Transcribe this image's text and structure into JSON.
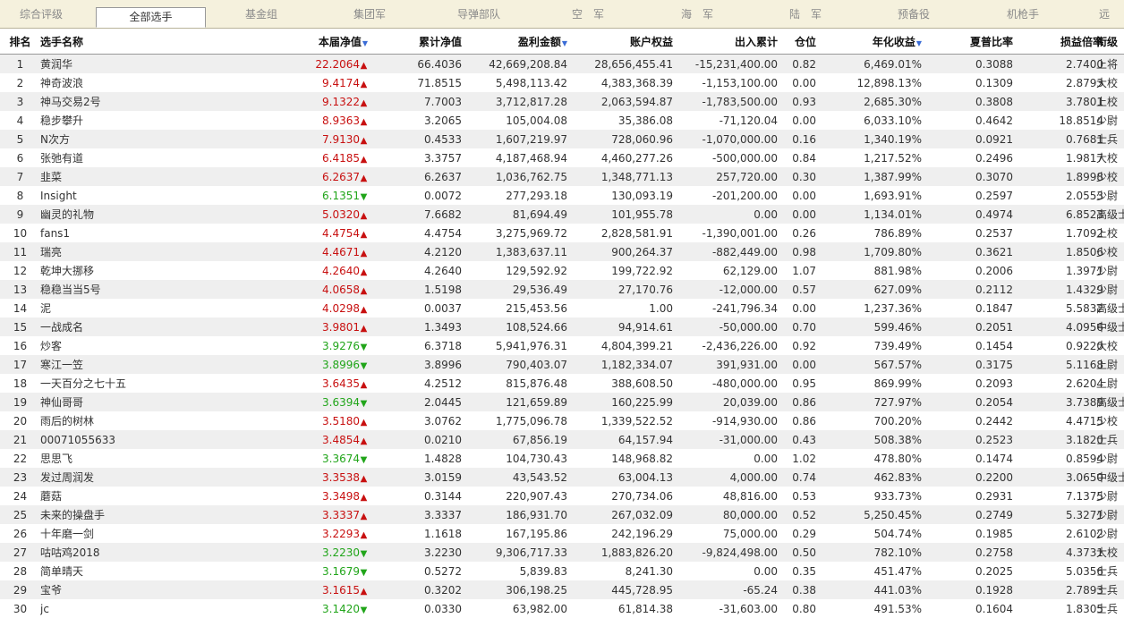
{
  "tabs": [
    {
      "label": "综合评级",
      "active": false
    },
    {
      "label": "全部选手",
      "active": true
    },
    {
      "label": "基金组",
      "active": false
    },
    {
      "label": "集团军",
      "active": false
    },
    {
      "label": "导弹部队",
      "active": false
    },
    {
      "label": "空　军",
      "active": false
    },
    {
      "label": "海　军",
      "active": false
    },
    {
      "label": "陆　军",
      "active": false
    },
    {
      "label": "预备役",
      "active": false
    },
    {
      "label": "机枪手",
      "active": false
    },
    {
      "label": "远",
      "active": false
    }
  ],
  "columns": {
    "rank": "排名",
    "name": "选手名称",
    "nav": "本届净值",
    "cum_nav": "累计净值",
    "profit": "盈利金额",
    "equity": "账户权益",
    "io": "出入累计",
    "pos": "仓位",
    "annual": "年化收益",
    "sharpe": "夏普比率",
    "pl_ratio": "损益倍率",
    "title": "衔级"
  },
  "sort_marker": "▼",
  "rows": [
    {
      "rank": "1",
      "name": "黄润华",
      "nav": "22.2064",
      "dir": "up",
      "cum_nav": "66.4036",
      "profit": "42,669,208.84",
      "equity": "28,656,455.41",
      "io": "-15,231,400.00",
      "pos": "0.82",
      "annual": "6,469.01%",
      "sharpe": "0.3088",
      "pl_ratio": "2.7400",
      "title": "上将"
    },
    {
      "rank": "2",
      "name": "神奇波浪",
      "nav": "9.4174",
      "dir": "up",
      "cum_nav": "71.8515",
      "profit": "5,498,113.42",
      "equity": "4,383,368.39",
      "io": "-1,153,100.00",
      "pos": "0.00",
      "annual": "12,898.13%",
      "sharpe": "0.1309",
      "pl_ratio": "2.8793",
      "title": "大校"
    },
    {
      "rank": "3",
      "name": "神马交易2号",
      "nav": "9.1322",
      "dir": "up",
      "cum_nav": "7.7003",
      "profit": "3,712,817.28",
      "equity": "2,063,594.87",
      "io": "-1,783,500.00",
      "pos": "0.93",
      "annual": "2,685.30%",
      "sharpe": "0.3808",
      "pl_ratio": "3.7801",
      "title": "上校"
    },
    {
      "rank": "4",
      "name": "稳步攀升",
      "nav": "8.9363",
      "dir": "up",
      "cum_nav": "3.2065",
      "profit": "105,004.08",
      "equity": "35,386.08",
      "io": "-71,120.04",
      "pos": "0.00",
      "annual": "6,033.10%",
      "sharpe": "0.4642",
      "pl_ratio": "18.8514",
      "title": "少尉"
    },
    {
      "rank": "5",
      "name": "N次方",
      "nav": "7.9130",
      "dir": "up",
      "cum_nav": "0.4533",
      "profit": "1,607,219.97",
      "equity": "728,060.96",
      "io": "-1,070,000.00",
      "pos": "0.16",
      "annual": "1,340.19%",
      "sharpe": "0.0921",
      "pl_ratio": "0.7681",
      "title": "士兵"
    },
    {
      "rank": "6",
      "name": "张弛有道",
      "nav": "6.4185",
      "dir": "up",
      "cum_nav": "3.3757",
      "profit": "4,187,468.94",
      "equity": "4,460,277.26",
      "io": "-500,000.00",
      "pos": "0.84",
      "annual": "1,217.52%",
      "sharpe": "0.2496",
      "pl_ratio": "1.9817",
      "title": "大校"
    },
    {
      "rank": "7",
      "name": "韭菜",
      "nav": "6.2637",
      "dir": "up",
      "cum_nav": "6.2637",
      "profit": "1,036,762.75",
      "equity": "1,348,771.13",
      "io": "257,720.00",
      "pos": "0.30",
      "annual": "1,387.99%",
      "sharpe": "0.3070",
      "pl_ratio": "1.8998",
      "title": "少校"
    },
    {
      "rank": "8",
      "name": "Insight",
      "nav": "6.1351",
      "dir": "down",
      "cum_nav": "0.0072",
      "profit": "277,293.18",
      "equity": "130,093.19",
      "io": "-201,200.00",
      "pos": "0.00",
      "annual": "1,693.91%",
      "sharpe": "0.2597",
      "pl_ratio": "2.0553",
      "title": "少尉"
    },
    {
      "rank": "9",
      "name": "幽灵的礼物",
      "nav": "5.0320",
      "dir": "up",
      "cum_nav": "7.6682",
      "profit": "81,694.49",
      "equity": "101,955.78",
      "io": "0.00",
      "pos": "0.00",
      "annual": "1,134.01%",
      "sharpe": "0.4974",
      "pl_ratio": "6.8523",
      "title": "高级士官"
    },
    {
      "rank": "10",
      "name": "fans1",
      "nav": "4.4754",
      "dir": "up",
      "cum_nav": "4.4754",
      "profit": "3,275,969.72",
      "equity": "2,828,581.91",
      "io": "-1,390,001.00",
      "pos": "0.26",
      "annual": "786.89%",
      "sharpe": "0.2537",
      "pl_ratio": "1.7092",
      "title": "上校"
    },
    {
      "rank": "11",
      "name": "瑞亮",
      "nav": "4.4671",
      "dir": "up",
      "cum_nav": "4.2120",
      "profit": "1,383,637.11",
      "equity": "900,264.37",
      "io": "-882,449.00",
      "pos": "0.98",
      "annual": "1,709.80%",
      "sharpe": "0.3621",
      "pl_ratio": "1.8506",
      "title": "少校"
    },
    {
      "rank": "12",
      "name": "乾坤大挪移",
      "nav": "4.2640",
      "dir": "up",
      "cum_nav": "4.2640",
      "profit": "129,592.92",
      "equity": "199,722.92",
      "io": "62,129.00",
      "pos": "1.07",
      "annual": "881.98%",
      "sharpe": "0.2006",
      "pl_ratio": "1.3971",
      "title": "少尉"
    },
    {
      "rank": "13",
      "name": "稳稳当当5号",
      "nav": "4.0658",
      "dir": "up",
      "cum_nav": "1.5198",
      "profit": "29,536.49",
      "equity": "27,170.76",
      "io": "-12,000.00",
      "pos": "0.57",
      "annual": "627.09%",
      "sharpe": "0.2112",
      "pl_ratio": "1.4329",
      "title": "少尉"
    },
    {
      "rank": "14",
      "name": "泥",
      "nav": "4.0298",
      "dir": "up",
      "cum_nav": "0.0037",
      "profit": "215,453.56",
      "equity": "1.00",
      "io": "-241,796.34",
      "pos": "0.00",
      "annual": "1,237.36%",
      "sharpe": "0.1847",
      "pl_ratio": "5.5832",
      "title": "高级士官"
    },
    {
      "rank": "15",
      "name": "一战成名",
      "nav": "3.9801",
      "dir": "up",
      "cum_nav": "1.3493",
      "profit": "108,524.66",
      "equity": "94,914.61",
      "io": "-50,000.00",
      "pos": "0.70",
      "annual": "599.46%",
      "sharpe": "0.2051",
      "pl_ratio": "4.0956",
      "title": "中级士官"
    },
    {
      "rank": "16",
      "name": "炒客",
      "nav": "3.9276",
      "dir": "down",
      "cum_nav": "6.3718",
      "profit": "5,941,976.31",
      "equity": "4,804,399.21",
      "io": "-2,436,226.00",
      "pos": "0.92",
      "annual": "739.49%",
      "sharpe": "0.1454",
      "pl_ratio": "0.9220",
      "title": "大校"
    },
    {
      "rank": "17",
      "name": "寒江一笠",
      "nav": "3.8996",
      "dir": "down",
      "cum_nav": "3.8996",
      "profit": "790,403.07",
      "equity": "1,182,334.07",
      "io": "391,931.00",
      "pos": "0.00",
      "annual": "567.57%",
      "sharpe": "0.3175",
      "pl_ratio": "5.1168",
      "title": "上尉"
    },
    {
      "rank": "18",
      "name": "一天百分之七十五",
      "nav": "3.6435",
      "dir": "up",
      "cum_nav": "4.2512",
      "profit": "815,876.48",
      "equity": "388,608.50",
      "io": "-480,000.00",
      "pos": "0.95",
      "annual": "869.99%",
      "sharpe": "0.2093",
      "pl_ratio": "2.6204",
      "title": "上尉"
    },
    {
      "rank": "19",
      "name": "神仙哥哥",
      "nav": "3.6394",
      "dir": "down",
      "cum_nav": "2.0445",
      "profit": "121,659.89",
      "equity": "160,225.99",
      "io": "20,039.00",
      "pos": "0.86",
      "annual": "727.97%",
      "sharpe": "0.2054",
      "pl_ratio": "3.7389",
      "title": "高级士官"
    },
    {
      "rank": "20",
      "name": "雨后的树林",
      "nav": "3.5180",
      "dir": "up",
      "cum_nav": "3.0762",
      "profit": "1,775,096.78",
      "equity": "1,339,522.52",
      "io": "-914,930.00",
      "pos": "0.86",
      "annual": "700.20%",
      "sharpe": "0.2442",
      "pl_ratio": "4.4715",
      "title": "少校"
    },
    {
      "rank": "21",
      "name": "00071055633",
      "nav": "3.4854",
      "dir": "up",
      "cum_nav": "0.0210",
      "profit": "67,856.19",
      "equity": "64,157.94",
      "io": "-31,000.00",
      "pos": "0.43",
      "annual": "508.38%",
      "sharpe": "0.2523",
      "pl_ratio": "3.1820",
      "title": "士兵"
    },
    {
      "rank": "22",
      "name": "思思飞",
      "nav": "3.3674",
      "dir": "down",
      "cum_nav": "1.4828",
      "profit": "104,730.43",
      "equity": "148,968.82",
      "io": "0.00",
      "pos": "1.02",
      "annual": "478.80%",
      "sharpe": "0.1474",
      "pl_ratio": "0.8594",
      "title": "少尉"
    },
    {
      "rank": "23",
      "name": "发过周润发",
      "nav": "3.3538",
      "dir": "up",
      "cum_nav": "3.0159",
      "profit": "43,543.52",
      "equity": "63,004.13",
      "io": "4,000.00",
      "pos": "0.74",
      "annual": "462.83%",
      "sharpe": "0.2200",
      "pl_ratio": "3.0650",
      "title": "中级士官"
    },
    {
      "rank": "24",
      "name": "蘑菇",
      "nav": "3.3498",
      "dir": "up",
      "cum_nav": "0.3144",
      "profit": "220,907.43",
      "equity": "270,734.06",
      "io": "48,816.00",
      "pos": "0.53",
      "annual": "933.73%",
      "sharpe": "0.2931",
      "pl_ratio": "7.1375",
      "title": "少尉"
    },
    {
      "rank": "25",
      "name": "未来的操盘手",
      "nav": "3.3337",
      "dir": "up",
      "cum_nav": "3.3337",
      "profit": "186,931.70",
      "equity": "267,032.09",
      "io": "80,000.00",
      "pos": "0.52",
      "annual": "5,250.45%",
      "sharpe": "0.2749",
      "pl_ratio": "5.3271",
      "title": "少尉"
    },
    {
      "rank": "26",
      "name": "十年磨一剑",
      "nav": "3.2293",
      "dir": "up",
      "cum_nav": "1.1618",
      "profit": "167,195.86",
      "equity": "242,196.29",
      "io": "75,000.00",
      "pos": "0.29",
      "annual": "504.74%",
      "sharpe": "0.1985",
      "pl_ratio": "2.6102",
      "title": "少尉"
    },
    {
      "rank": "27",
      "name": "咕咕鸡2018",
      "nav": "3.2230",
      "dir": "down",
      "cum_nav": "3.2230",
      "profit": "9,306,717.33",
      "equity": "1,883,826.20",
      "io": "-9,824,498.00",
      "pos": "0.50",
      "annual": "782.10%",
      "sharpe": "0.2758",
      "pl_ratio": "4.3731",
      "title": "大校"
    },
    {
      "rank": "28",
      "name": "简单晴天",
      "nav": "3.1679",
      "dir": "down",
      "cum_nav": "0.5272",
      "profit": "5,839.83",
      "equity": "8,241.30",
      "io": "0.00",
      "pos": "0.35",
      "annual": "451.47%",
      "sharpe": "0.2025",
      "pl_ratio": "5.0356",
      "title": "士兵"
    },
    {
      "rank": "29",
      "name": "宝爷",
      "nav": "3.1615",
      "dir": "up",
      "cum_nav": "0.3202",
      "profit": "306,198.25",
      "equity": "445,728.95",
      "io": "-65.24",
      "pos": "0.38",
      "annual": "441.03%",
      "sharpe": "0.1928",
      "pl_ratio": "2.7893",
      "title": "士兵"
    },
    {
      "rank": "30",
      "name": "jc",
      "nav": "3.1420",
      "dir": "down",
      "cum_nav": "0.0330",
      "profit": "63,982.00",
      "equity": "61,814.38",
      "io": "-31,603.00",
      "pos": "0.80",
      "annual": "491.53%",
      "sharpe": "0.1604",
      "pl_ratio": "1.8305",
      "title": "士兵"
    }
  ]
}
